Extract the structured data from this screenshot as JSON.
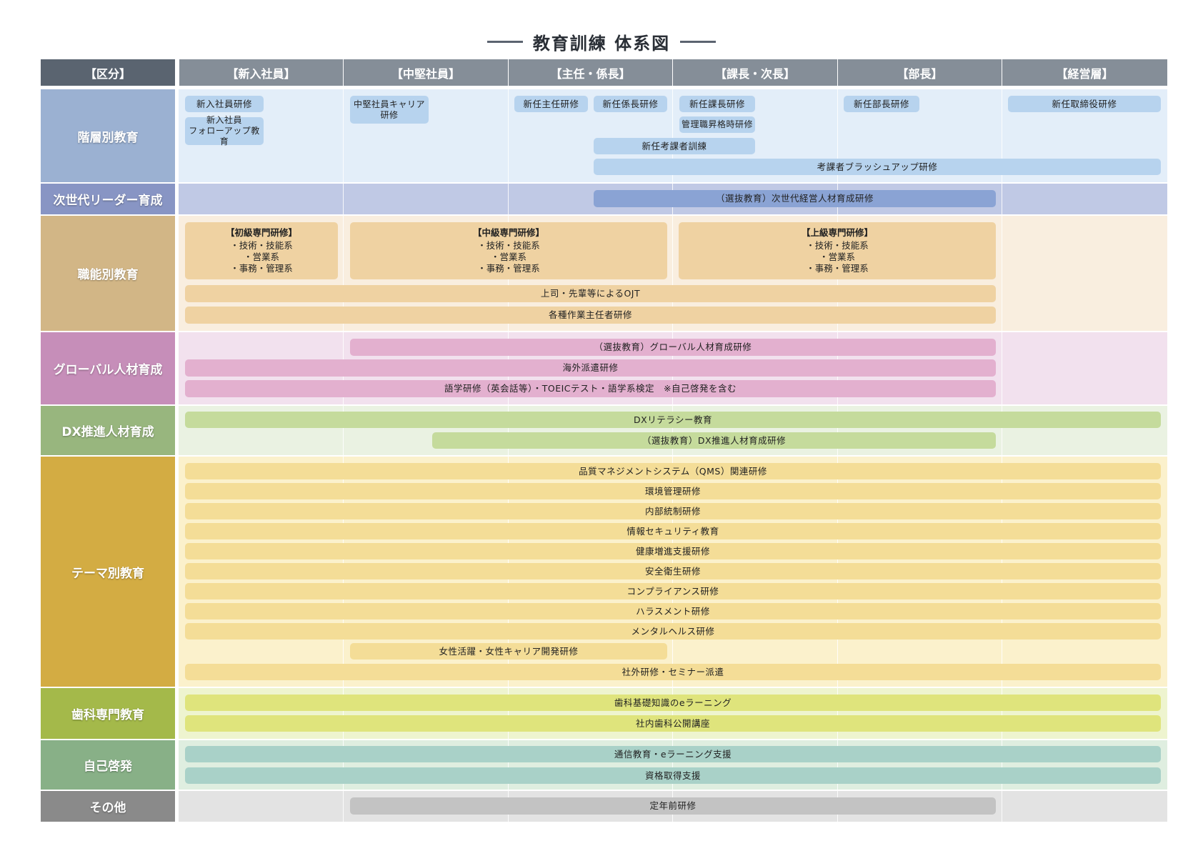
{
  "title": "教育訓練 体系図",
  "header": {
    "kubun": "【区分】",
    "levels": [
      "【新入社員】",
      "【中堅社員】",
      "【主任・係長】",
      "【課長・次長】",
      "【部長】",
      "【経営層】"
    ]
  },
  "colors": {
    "kaisou": {
      "label": "#9bb1d2",
      "bg": "#e3eef9",
      "pill": "#b7d3ee"
    },
    "leader": {
      "label": "#8895c4",
      "bg": "#c0c9e5",
      "pill": "#8aa3d4"
    },
    "shokunou": {
      "label": "#d2b686",
      "bg": "#f9eedf",
      "pill": "#efd2a2"
    },
    "global": {
      "label": "#c68eb9",
      "bg": "#f2e1ee",
      "pill": "#e3b0cf"
    },
    "dx": {
      "label": "#98b67e",
      "bg": "#eaf2e2",
      "pill": "#c5db9c"
    },
    "theme": {
      "label": "#d3ac43",
      "bg": "#fbf1cc",
      "pill": "#f4dd97"
    },
    "shika": {
      "label": "#a4b94a",
      "bg": "#eef4cf",
      "pill": "#dfe47c"
    },
    "jiko": {
      "label": "#88b087",
      "bg": "#dfeee0",
      "pill": "#a9d1c8"
    },
    "other": {
      "label": "#8a8a8a",
      "bg": "#e3e3e3",
      "pill": "#c3c3c3"
    }
  },
  "rows": {
    "kaisou": {
      "label": "階層別教育",
      "items": [
        "新入社員研修",
        "新入社員\nフォローアップ教育",
        "中堅社員キャリア\n研修",
        "新任主任研修",
        "新任係長研修",
        "新任課長研修",
        "管理職昇格時研修",
        "新任考課者訓練",
        "考課者ブラッシュアップ研修",
        "新任部長研修",
        "新任取締役研修"
      ]
    },
    "leader": {
      "label": "次世代リーダー育成",
      "items": [
        "（選抜教育）次世代経営人材育成研修"
      ]
    },
    "shokunou": {
      "label": "職能別教育",
      "boxes": [
        {
          "title": "【初級専門研修】",
          "lines": [
            "・技術・技能系",
            "・営業系",
            "・事務・管理系"
          ]
        },
        {
          "title": "【中級専門研修】",
          "lines": [
            "・技術・技能系",
            "・営業系",
            "・事務・管理系"
          ]
        },
        {
          "title": "【上級専門研修】",
          "lines": [
            "・技術・技能系",
            "・営業系",
            "・事務・管理系"
          ]
        }
      ],
      "items": [
        "上司・先輩等によるOJT",
        "各種作業主任者研修"
      ]
    },
    "global": {
      "label": "グローバル人材育成",
      "items": [
        "（選抜教育）グローバル人材育成研修",
        "海外派遣研修",
        "語学研修（英会話等）・TOEICテスト・語学系検定　※自己啓発を含む"
      ]
    },
    "dx": {
      "label": "DX推進人材育成",
      "items": [
        "DXリテラシー教育",
        "（選抜教育）DX推進人材育成研修"
      ]
    },
    "theme": {
      "label": "テーマ別教育",
      "items": [
        "品質マネジメントシステム（QMS）関連研修",
        "環境管理研修",
        "内部統制研修",
        "情報セキュリティ教育",
        "健康増進支援研修",
        "安全衛生研修",
        "コンプライアンス研修",
        "ハラスメント研修",
        "メンタルヘルス研修",
        "女性活躍・女性キャリア開発研修",
        "社外研修・セミナー派遣"
      ]
    },
    "shika": {
      "label": "歯科専門教育",
      "items": [
        "歯科基礎知識のeラーニング",
        "社内歯科公開講座"
      ]
    },
    "jiko": {
      "label": "自己啓発",
      "items": [
        "通信教育・eラーニング支援",
        "資格取得支援"
      ]
    },
    "other": {
      "label": "その他",
      "items": [
        "定年前研修"
      ]
    }
  }
}
